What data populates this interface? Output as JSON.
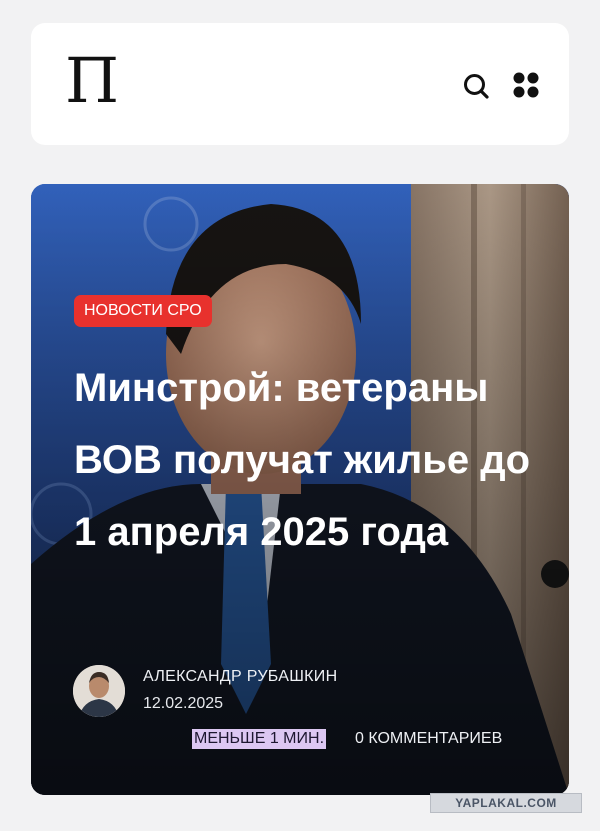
{
  "header": {
    "logo": "П",
    "search_icon": "search-icon",
    "menu_icon": "grid-menu-icon"
  },
  "article": {
    "category": "НОВОСТИ СРО",
    "headline": "Минстрой: ветераны ВОВ получат жилье до 1 апреля 2025 года",
    "author": "АЛЕКСАНДР РУБАШКИН",
    "date": "12.02.2025",
    "read_time": "МЕНЬШЕ 1 МИН.",
    "comments": "0 КОММЕНТАРИЕВ"
  },
  "watermark": "YAPLAKAL.COM",
  "colors": {
    "badge": "#e8312d",
    "read_time_highlight": "#dcc7f2",
    "header_bg": "#ffffff",
    "page_bg": "#f2f2f3"
  }
}
